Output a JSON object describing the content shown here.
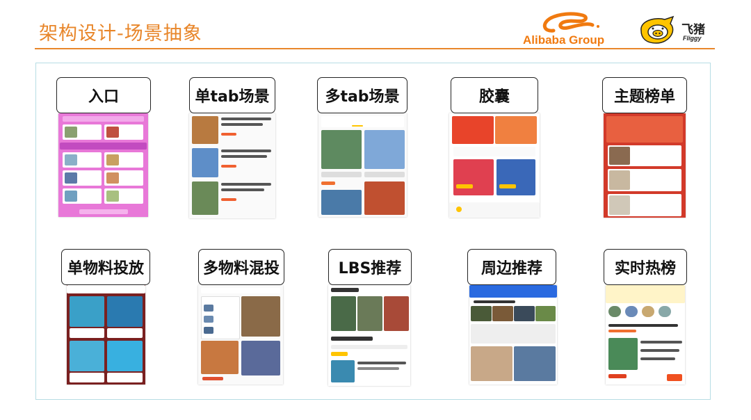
{
  "header": {
    "title": "架构设计-场景抽象",
    "alibaba_logo_text": "Alibaba Group",
    "fliggy_logo_text": "飞猪",
    "fliggy_logo_sub": "Fliggy"
  },
  "scenes": [
    {
      "label": "入口"
    },
    {
      "label": "单tab场景"
    },
    {
      "label": "多tab场景"
    },
    {
      "label": "胶囊"
    },
    {
      "label": "主题榜单"
    },
    {
      "label": "单物料投放"
    },
    {
      "label": "多物料混投"
    },
    {
      "label": "LBS推荐"
    },
    {
      "label": "周边推荐"
    },
    {
      "label": "实时热榜"
    }
  ],
  "colors": {
    "title": "#E8862A",
    "frame_border": "#B6DDE4",
    "label_border": "#222222"
  },
  "icons": [
    "alibaba-logo-icon",
    "fliggy-logo-icon"
  ]
}
